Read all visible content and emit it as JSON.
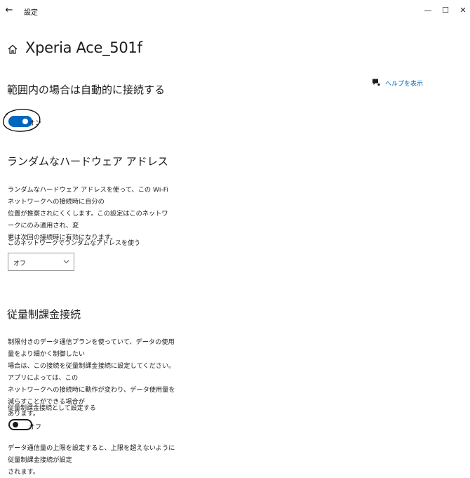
{
  "titlebar": {
    "app_title": "設定",
    "back_icon": "back-arrow-icon",
    "minimize": "—",
    "maximize": "☐",
    "close": "✕"
  },
  "header": {
    "home_icon": "home-icon",
    "title": "Xperia Ace_501f"
  },
  "help": {
    "icon": "help-chat-icon",
    "label": "ヘルプを表示"
  },
  "auto_connect": {
    "title": "範囲内の場合は自動的に接続する",
    "toggle_state": "オン",
    "toggle_on": true,
    "accent_color": "#0067c0"
  },
  "random_hw": {
    "title": "ランダムなハードウェア アドレス",
    "description": [
      "ランダムなハードウェア アドレスを使って、この Wi-Fi ネットワークへの接続時に自分の",
      "位置が推察されにくくします。この設定はこのネットワークにのみ適用され、変",
      "更は次回の接続時に有効になります。"
    ],
    "dropdown_label": "このネットワークでランダムなアドレスを使う",
    "dropdown_value": "オフ"
  },
  "metered": {
    "title": "従量制課金接続",
    "description": [
      "制限付きのデータ通信プランを使っていて、データの使用量をより細かく制御したい",
      "場合は、この接続を従量制課金接続に設定してください。アプリによっては、この",
      "ネットワークへの接続時に動作が変わり、データ使用量を減らすことができる場合が",
      "あります。"
    ],
    "toggle_label": "従量制課金接続として設定する",
    "toggle_state": "オフ",
    "toggle_on": false,
    "limit_text": "データ通信量の上限を設定すると、上限を超えないように従量制課金接続が設定",
    "limit_text_2": "されます。"
  }
}
